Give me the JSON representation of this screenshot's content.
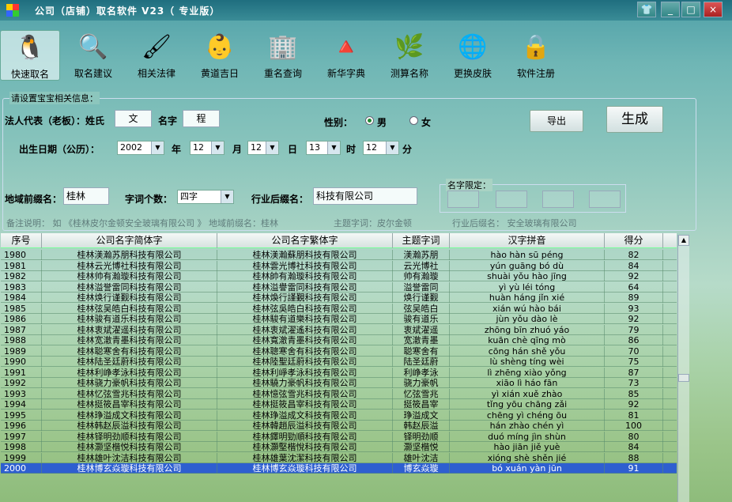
{
  "window": {
    "title": "公司（店铺）取名软件 V23（ 专业版）",
    "min": "_",
    "max": "□",
    "close": "×",
    "skin": "👕"
  },
  "toolbar": [
    {
      "label": "快速取名",
      "icon": "🐧"
    },
    {
      "label": "取名建议",
      "icon": "🔍"
    },
    {
      "label": "相关法律",
      "icon": "🖌"
    },
    {
      "label": "黄道吉日",
      "icon": "👶"
    },
    {
      "label": "重名查询",
      "icon": "🏢"
    },
    {
      "label": "新华字典",
      "icon": "🔺"
    },
    {
      "label": "测算名称",
      "icon": "🌿"
    },
    {
      "label": "更换皮肤",
      "icon": "🌐"
    },
    {
      "label": "软件注册",
      "icon": "🔒"
    }
  ],
  "form": {
    "section": "请设置宝宝相关信息：",
    "rep_label": "法人代表（老板）：姓氏",
    "surname": "文",
    "name_label": "名字",
    "given": "程",
    "gender_label": "性别：",
    "male": "男",
    "female": "女",
    "export": "导出",
    "generate": "生成",
    "birth_label": "出生日期（公历）：",
    "year": "2002",
    "y": "年",
    "month": "12",
    "m": "月",
    "day": "12",
    "d": "日",
    "hour": "13",
    "h": "时",
    "minute": "12",
    "mi": "分",
    "prefix_label": "地域前缀名：",
    "prefix": "桂林",
    "count_label": "字词个数：",
    "count": "四字",
    "suffix_label": "行业后缀名：",
    "suffix": "科技有限公司",
    "limit_label": "名字限定：",
    "note1": "备注说明：  如 《桂林皮尔金顿安全玻璃有限公司 》  地域前缀名：桂林",
    "note2": "主题字词：皮尔金顿",
    "note3": "行业后缀名：  安全玻璃有限公司"
  },
  "table": {
    "headers": [
      "序号",
      "公司名字简体字",
      "公司名字繁体字",
      "主题字词",
      "汉字拼音",
      "得分"
    ],
    "rows": [
      [
        "1980",
        "桂林渼瀚苏朋科技有限公司",
        "桂林渼瀚蘇朋科技有限公司",
        "渼瀚苏朋",
        "hào hàn sū péng",
        "82"
      ],
      [
        "1981",
        "桂林云光博社科技有限公司",
        "桂林雲光博社科技有限公司",
        "云光博社",
        "yún guāng bó dù",
        "84"
      ],
      [
        "1982",
        "桂林帅有瀚璇科技有限公司",
        "桂林帥有瀚璇科技有限公司",
        "帅有瀚璇",
        "shuài yǒu hào jīng",
        "92"
      ],
      [
        "1983",
        "桂林溢誉雷同科技有限公司",
        "桂林溢譽雷同科技有限公司",
        "溢誉雷同",
        "yì yù léi tóng",
        "64"
      ],
      [
        "1984",
        "桂林焕行谨觐科技有限公司",
        "桂林煥行謹覲科技有限公司",
        "焕行谨觐",
        "huàn háng jǐn xié",
        "89"
      ],
      [
        "1985",
        "桂林弦吴皓白科技有限公司",
        "桂林弦吳皓白科技有限公司",
        "弦吴皓白",
        "xián wú hào bái",
        "93"
      ],
      [
        "1986",
        "桂林骏有道乐科技有限公司",
        "桂林駿有道樂科技有限公司",
        "骏有道乐",
        "jùn yǒu dào lè",
        "92"
      ],
      [
        "1987",
        "桂林衷斌濯遥科技有限公司",
        "桂林衷斌濯遙科技有限公司",
        "衷斌濯遥",
        "zhōng bīn zhuó yáo",
        "79"
      ],
      [
        "1988",
        "桂林宽澈青墨科技有限公司",
        "桂林寬澈青墨科技有限公司",
        "宽澈青墨",
        "kuān chè qīng mò",
        "86"
      ],
      [
        "1989",
        "桂林聪寒舍有科技有限公司",
        "桂林聰寒舍有科技有限公司",
        "聪寒舍有",
        "cōng hán shě yǒu",
        "70"
      ],
      [
        "1990",
        "桂林陆圣廷蔚科技有限公司",
        "桂林陸聖廷蔚科技有限公司",
        "陆圣廷蔚",
        "lù shèng tíng wèi",
        "75"
      ],
      [
        "1991",
        "桂林利峥孝泳科技有限公司",
        "桂林利崢孝泳科技有限公司",
        "利峥孝泳",
        "lì zhēng xiào yǒng",
        "87"
      ],
      [
        "1992",
        "桂林骁力豪帆科技有限公司",
        "桂林驍力豪帆科技有限公司",
        "骁力豪帆",
        "xiāo lì háo fān",
        "73"
      ],
      [
        "1993",
        "桂林忆弦雪兆科技有限公司",
        "桂林憶弦雪兆科技有限公司",
        "忆弦雪兆",
        "yì xián xuě zhào",
        "85"
      ],
      [
        "1994",
        "桂林挺筱昌宰科技有限公司",
        "桂林挺筱昌宰科技有限公司",
        "挺筱昌宰",
        "tǐng yōu chāng zǎi",
        "92"
      ],
      [
        "1995",
        "桂林琤溢成文科技有限公司",
        "桂林琤溢成文科技有限公司",
        "琤溢成文",
        "chēng yì chéng ōu",
        "81"
      ],
      [
        "1996",
        "桂林韩赵辰溢科技有限公司",
        "桂林韓趙辰溢科技有限公司",
        "韩赵辰溢",
        "hán zhào chén yì",
        "100"
      ],
      [
        "1997",
        "桂林铎明劲顺科技有限公司",
        "桂林鐸明勁順科技有限公司",
        "铎明劲顺",
        "duó míng jìn shùn",
        "80"
      ],
      [
        "1998",
        "桂林灏坚楷悦科技有限公司",
        "桂林灝堅楷悅科技有限公司",
        "灏坚楷悦",
        "hào jiān jiě yuè",
        "84"
      ],
      [
        "1999",
        "桂林雄叶沈洁科技有限公司",
        "桂林雄葉沈潔科技有限公司",
        "雄叶沈洁",
        "xióng shè shěn jié",
        "88"
      ],
      [
        "2000",
        "桂林博玄焱璇科技有限公司",
        "桂林博玄焱璇科技有限公司",
        "博玄焱璇",
        "bó xuán yàn jūn",
        "91"
      ]
    ]
  }
}
